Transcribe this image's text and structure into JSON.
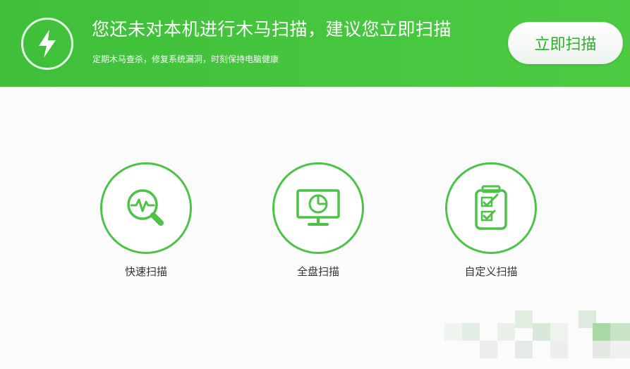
{
  "banner": {
    "icon": "lightning-icon",
    "headline": "您还未对本机进行木马扫描，建议您立即扫描",
    "subline": "定期木马查杀，修复系统漏洞，时刻保持电脑健康",
    "scan_now_label": "立即扫描"
  },
  "options": [
    {
      "label": "快速扫描",
      "icon": "magnifier-pulse-icon"
    },
    {
      "label": "全盘扫描",
      "icon": "monitor-pie-icon"
    },
    {
      "label": "自定义扫描",
      "icon": "checklist-icon"
    }
  ],
  "colors": {
    "accent": "#47c63f",
    "ring": "#4cc347",
    "text": "#333333"
  }
}
